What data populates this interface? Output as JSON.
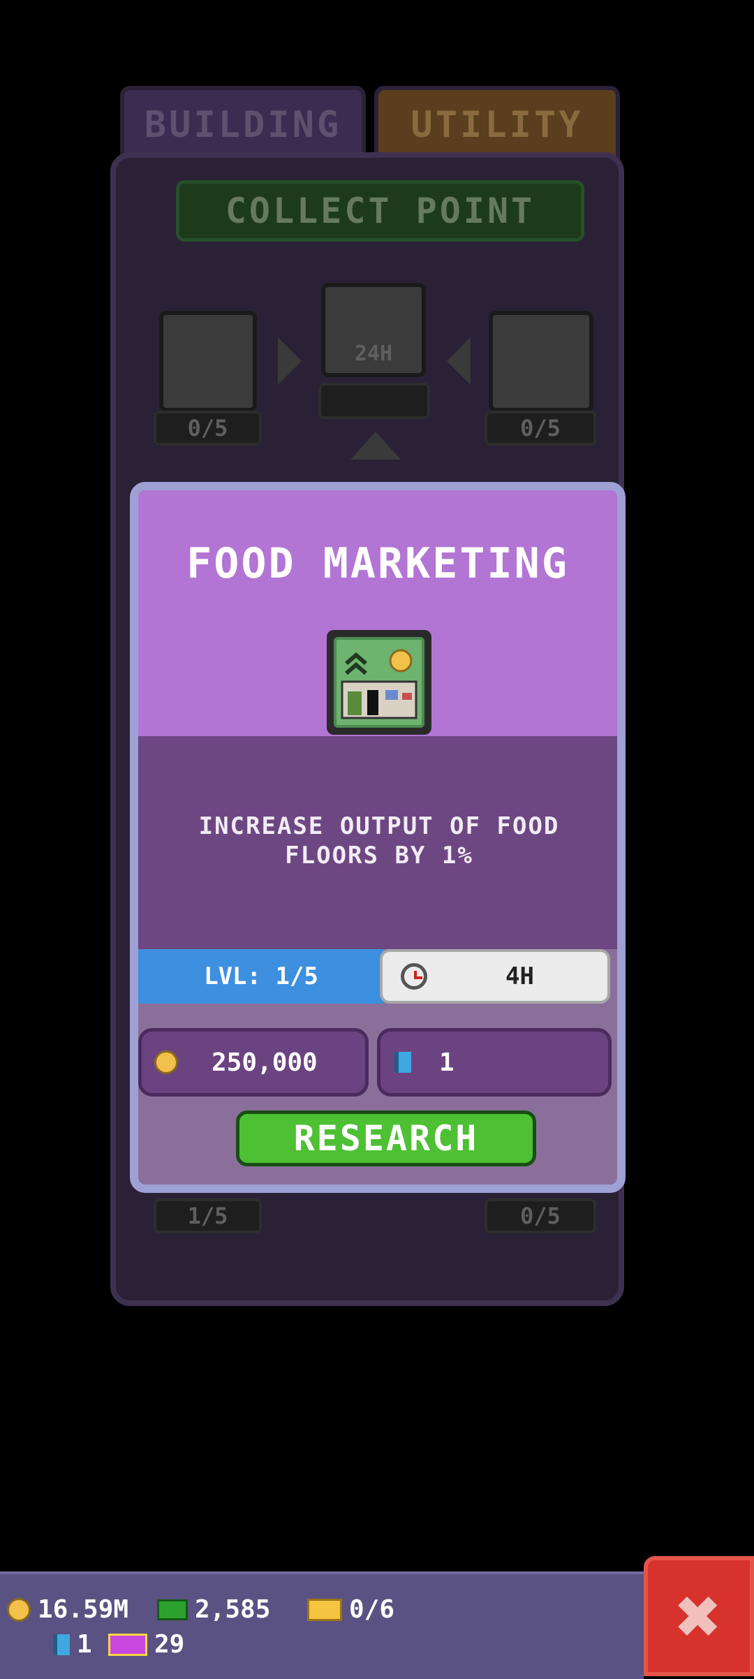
{
  "tabs": {
    "building": "BUILDING",
    "utility": "UTILITY"
  },
  "collect_point": "COLLECT POINT",
  "tree": {
    "center_timer": "24H",
    "left_count": "0/5",
    "right_count": "0/5",
    "bottom_left_count": "1/5",
    "bottom_right_count": "0/5"
  },
  "modal": {
    "title": "FOOD MARKETING",
    "description": "INCREASE OUTPUT OF FOOD FLOORS BY 1%",
    "level": "LVL: 1/5",
    "duration": "4H",
    "coin_cost": "250,000",
    "gem_cost": "1",
    "research_label": "RESEARCH"
  },
  "resources": {
    "coins": "16.59M",
    "cash": "2,585",
    "tickets": "0/6",
    "gems": "1",
    "vip": "29"
  },
  "colors": {
    "modal_top": "#b275d4",
    "modal_mid": "#6d4782",
    "research_button": "#4dc033",
    "level_bar": "#3d8fe0",
    "close_button": "#d7322d"
  }
}
